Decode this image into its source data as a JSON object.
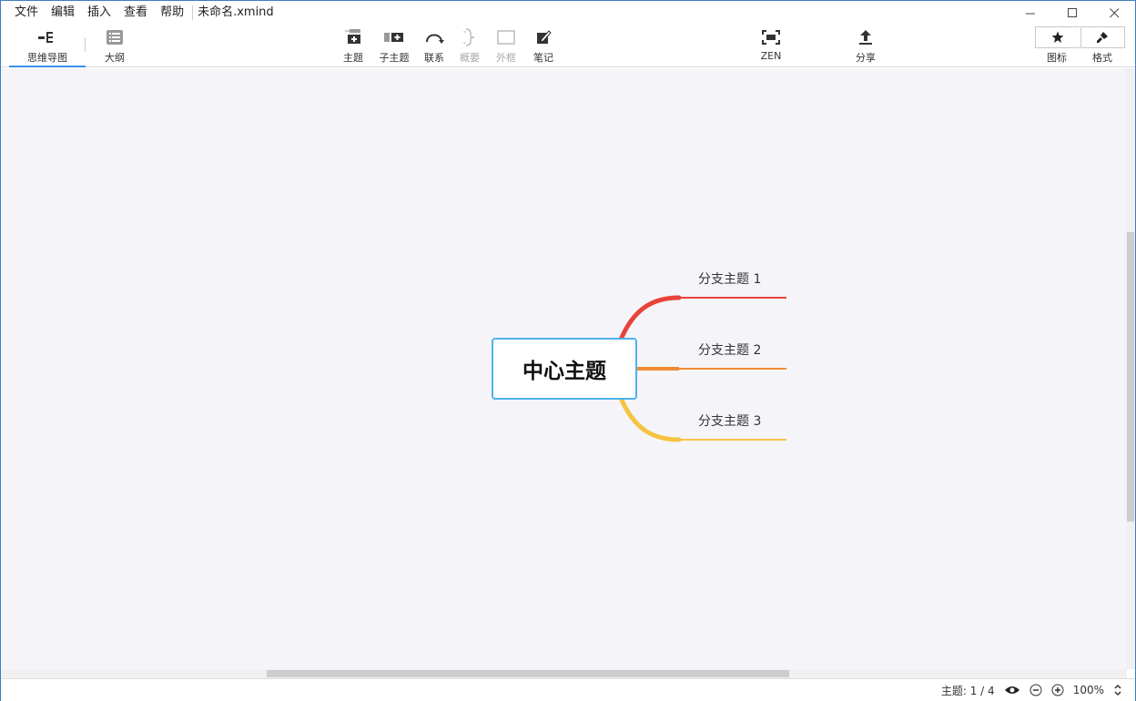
{
  "menu": {
    "items": [
      "文件",
      "编辑",
      "插入",
      "查看",
      "帮助"
    ],
    "doc_title": "未命名.xmind"
  },
  "window_controls": {
    "minimize": "—",
    "maximize": "☐",
    "close": "✕"
  },
  "view_tabs": {
    "mindmap": "思维导图",
    "outline": "大纲",
    "active": "mindmap"
  },
  "toolbar": {
    "topic": "主题",
    "subtopic": "子主题",
    "relationship": "联系",
    "summary": "概要",
    "boundary": "外框",
    "notes": "笔记",
    "zen": "ZEN",
    "share": "分享",
    "icons": "图标",
    "format": "格式"
  },
  "mindmap": {
    "central_topic": "中心主题",
    "branches": [
      {
        "label": "分支主题 1",
        "color": "#e8433a"
      },
      {
        "label": "分支主题 2",
        "color": "#ef8c33"
      },
      {
        "label": "分支主题 3",
        "color": "#f6c343"
      }
    ],
    "central_border_color": "#4cb2ea",
    "canvas_color": "#f5f5f9"
  },
  "status": {
    "topic_count": "主题: 1 / 4",
    "zoom": "100%"
  }
}
